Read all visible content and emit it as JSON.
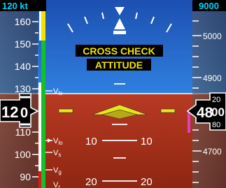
{
  "airspeed": {
    "selected": "120 kt",
    "current_tens": "12",
    "current_ones": "0",
    "tape_ticks": [
      "160",
      "150",
      "140",
      "130",
      "110",
      "100",
      "90"
    ],
    "vspeed_labels": {
      "vle": "V",
      "vle_sub": "le",
      "vlo": "V",
      "vlo_sub": "lo",
      "vs": "V",
      "vs_sub": "s",
      "vg": "V",
      "vg_sub": "g",
      "vr": "V",
      "vr_sub": "r"
    }
  },
  "attitude": {
    "annunciation_line1": "CROSS CHECK",
    "annunciation_line2": "ATTITUDE",
    "pitch_ladder": {
      "down10_left": "10",
      "down10_right": "10",
      "down20_left": "20",
      "down20_right": "20"
    }
  },
  "altimeter": {
    "selected": "9000",
    "tape_ticks": [
      "5000",
      "4900",
      "4700"
    ],
    "current_main": "48",
    "current_roll_top": "20",
    "current_roll_mid": "00",
    "current_roll_bot": "80"
  },
  "colors": {
    "sky": "#2a6fd0",
    "ground": "#b4321c",
    "caution": "#f2e100",
    "selected_readout": "#00d4ff",
    "speed_green": "#12c12a",
    "speed_white": "#ffffff",
    "speed_red": "#d8181b",
    "trend_magenta": "#e040c0"
  }
}
